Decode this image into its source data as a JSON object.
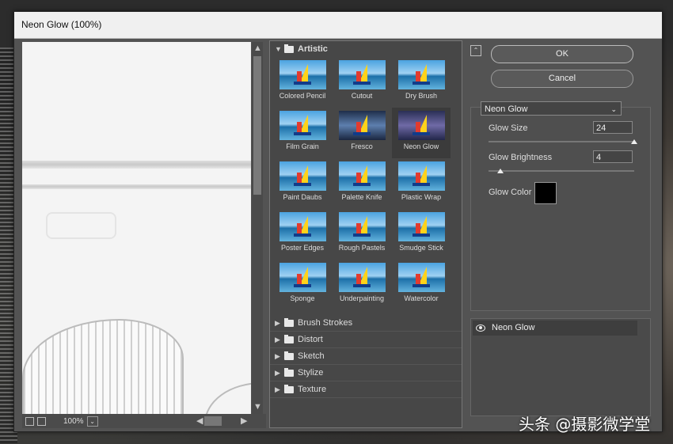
{
  "window": {
    "title": "Neon Glow (100%)"
  },
  "preview": {
    "zoom": "100%"
  },
  "gallery": {
    "open_category": "Artistic",
    "filters": [
      {
        "label": "Colored Pencil"
      },
      {
        "label": "Cutout"
      },
      {
        "label": "Dry Brush"
      },
      {
        "label": "Film Grain"
      },
      {
        "label": "Fresco"
      },
      {
        "label": "Neon Glow",
        "selected": true
      },
      {
        "label": "Paint Daubs"
      },
      {
        "label": "Palette Knife"
      },
      {
        "label": "Plastic Wrap"
      },
      {
        "label": "Poster Edges"
      },
      {
        "label": "Rough Pastels"
      },
      {
        "label": "Smudge Stick"
      },
      {
        "label": "Sponge"
      },
      {
        "label": "Underpainting"
      },
      {
        "label": "Watercolor"
      }
    ],
    "categories": [
      "Brush Strokes",
      "Distort",
      "Sketch",
      "Stylize",
      "Texture"
    ]
  },
  "buttons": {
    "ok": "OK",
    "cancel": "Cancel"
  },
  "settings": {
    "filter_select": "Neon Glow",
    "glow_size_label": "Glow Size",
    "glow_size_value": "24",
    "glow_brightness_label": "Glow Brightness",
    "glow_brightness_value": "4",
    "glow_color_label": "Glow Color",
    "glow_color": "#000000"
  },
  "layers": {
    "active": "Neon Glow"
  },
  "watermark": "头条 @摄影微学堂"
}
